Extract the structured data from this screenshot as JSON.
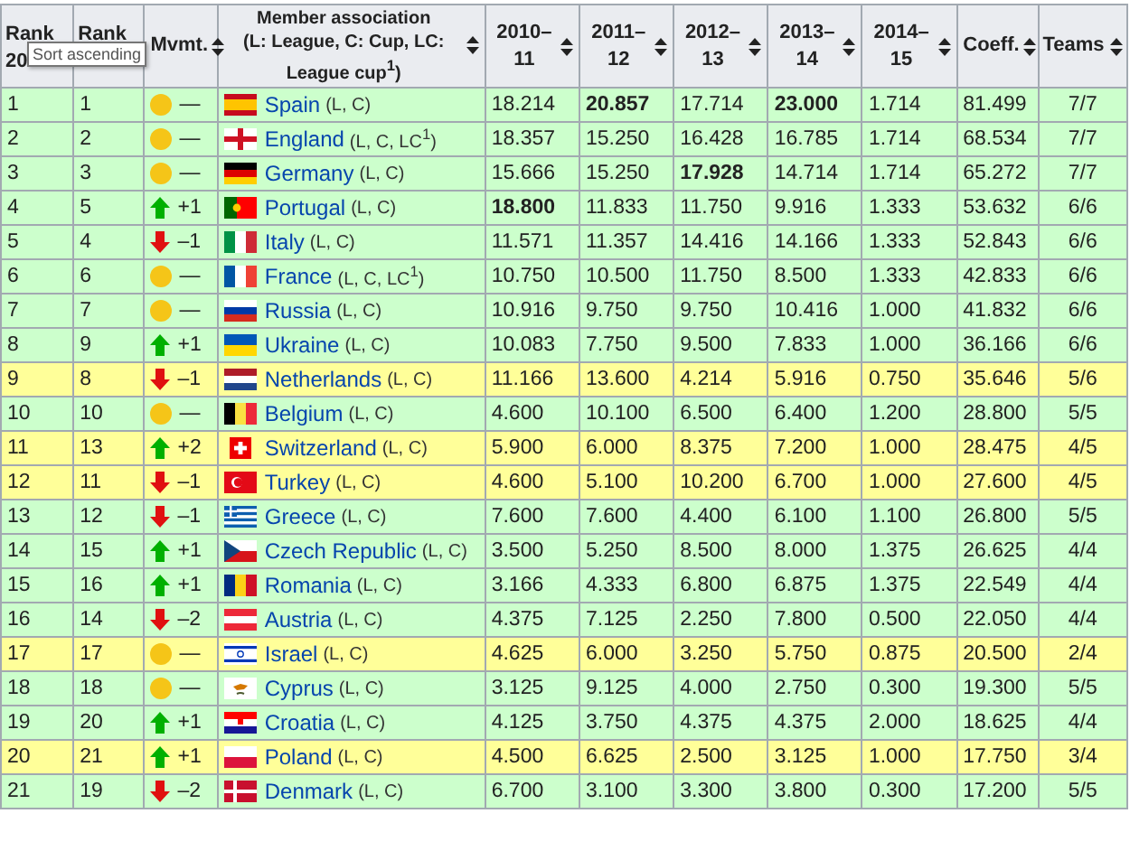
{
  "tooltip": "Sort ascending",
  "columns": [
    {
      "label": "Rank\n20",
      "sortable": false
    },
    {
      "label": "Rank",
      "sortable": false
    },
    {
      "label": "Mvmt.",
      "sortable": true
    },
    {
      "label": "Member association\n(L: League, C: Cup, LC: League cup$^{1}$)",
      "sortable": true
    },
    {
      "label": "2010–\n11",
      "sortable": true
    },
    {
      "label": "2011–\n12",
      "sortable": true
    },
    {
      "label": "2012–\n13",
      "sortable": true
    },
    {
      "label": "2013–\n14",
      "sortable": true
    },
    {
      "label": "2014–\n15",
      "sortable": true
    },
    {
      "label": "Coeff.",
      "sortable": true
    },
    {
      "label": "Teams",
      "sortable": true
    }
  ],
  "rows": [
    {
      "rank": "1",
      "prev": "1",
      "move": {
        "kind": "same",
        "text": "—"
      },
      "name": "Spain",
      "comps": "(L, C)",
      "seasons": [
        {
          "v": "18.214",
          "bold": false
        },
        {
          "v": "20.857",
          "bold": true
        },
        {
          "v": "17.714",
          "bold": false
        },
        {
          "v": "23.000",
          "bold": true
        },
        {
          "v": "1.714",
          "bold": false
        }
      ],
      "coeff": "81.499",
      "teams": "7/7",
      "color": "#ccffcc"
    },
    {
      "rank": "2",
      "prev": "2",
      "move": {
        "kind": "same",
        "text": "—"
      },
      "name": "England",
      "comps": "(L, C, LC$^{1}$)",
      "seasons": [
        {
          "v": "18.357",
          "bold": false
        },
        {
          "v": "15.250",
          "bold": false
        },
        {
          "v": "16.428",
          "bold": false
        },
        {
          "v": "16.785",
          "bold": false
        },
        {
          "v": "1.714",
          "bold": false
        }
      ],
      "coeff": "68.534",
      "teams": "7/7",
      "color": "#ccffcc"
    },
    {
      "rank": "3",
      "prev": "3",
      "move": {
        "kind": "same",
        "text": "—"
      },
      "name": "Germany",
      "comps": "(L, C)",
      "seasons": [
        {
          "v": "15.666",
          "bold": false
        },
        {
          "v": "15.250",
          "bold": false
        },
        {
          "v": "17.928",
          "bold": true
        },
        {
          "v": "14.714",
          "bold": false
        },
        {
          "v": "1.714",
          "bold": false
        }
      ],
      "coeff": "65.272",
      "teams": "7/7",
      "color": "#ccffcc"
    },
    {
      "rank": "4",
      "prev": "5",
      "move": {
        "kind": "up",
        "text": "+1"
      },
      "name": "Portugal",
      "comps": "(L, C)",
      "seasons": [
        {
          "v": "18.800",
          "bold": true
        },
        {
          "v": "11.833",
          "bold": false
        },
        {
          "v": "11.750",
          "bold": false
        },
        {
          "v": "9.916",
          "bold": false
        },
        {
          "v": "1.333",
          "bold": false
        }
      ],
      "coeff": "53.632",
      "teams": "6/6",
      "color": "#ccffcc"
    },
    {
      "rank": "5",
      "prev": "4",
      "move": {
        "kind": "down",
        "text": "–1"
      },
      "name": "Italy",
      "comps": "(L, C)",
      "seasons": [
        {
          "v": "11.571",
          "bold": false
        },
        {
          "v": "11.357",
          "bold": false
        },
        {
          "v": "14.416",
          "bold": false
        },
        {
          "v": "14.166",
          "bold": false
        },
        {
          "v": "1.333",
          "bold": false
        }
      ],
      "coeff": "52.843",
      "teams": "6/6",
      "color": "#ccffcc"
    },
    {
      "rank": "6",
      "prev": "6",
      "move": {
        "kind": "same",
        "text": "—"
      },
      "name": "France",
      "comps": "(L, C, LC$^{1}$)",
      "seasons": [
        {
          "v": "10.750",
          "bold": false
        },
        {
          "v": "10.500",
          "bold": false
        },
        {
          "v": "11.750",
          "bold": false
        },
        {
          "v": "8.500",
          "bold": false
        },
        {
          "v": "1.333",
          "bold": false
        }
      ],
      "coeff": "42.833",
      "teams": "6/6",
      "color": "#ccffcc"
    },
    {
      "rank": "7",
      "prev": "7",
      "move": {
        "kind": "same",
        "text": "—"
      },
      "name": "Russia",
      "comps": "(L, C)",
      "seasons": [
        {
          "v": "10.916",
          "bold": false
        },
        {
          "v": "9.750",
          "bold": false
        },
        {
          "v": "9.750",
          "bold": false
        },
        {
          "v": "10.416",
          "bold": false
        },
        {
          "v": "1.000",
          "bold": false
        }
      ],
      "coeff": "41.832",
      "teams": "6/6",
      "color": "#ccffcc"
    },
    {
      "rank": "8",
      "prev": "9",
      "move": {
        "kind": "up",
        "text": "+1"
      },
      "name": "Ukraine",
      "comps": "(L, C)",
      "seasons": [
        {
          "v": "10.083",
          "bold": false
        },
        {
          "v": "7.750",
          "bold": false
        },
        {
          "v": "9.500",
          "bold": false
        },
        {
          "v": "7.833",
          "bold": false
        },
        {
          "v": "1.000",
          "bold": false
        }
      ],
      "coeff": "36.166",
      "teams": "6/6",
      "color": "#ccffcc"
    },
    {
      "rank": "9",
      "prev": "8",
      "move": {
        "kind": "down",
        "text": "–1"
      },
      "name": "Netherlands",
      "comps": "(L, C)",
      "seasons": [
        {
          "v": "11.166",
          "bold": false
        },
        {
          "v": "13.600",
          "bold": false
        },
        {
          "v": "4.214",
          "bold": false
        },
        {
          "v": "5.916",
          "bold": false
        },
        {
          "v": "0.750",
          "bold": false
        }
      ],
      "coeff": "35.646",
      "teams": "5/6",
      "color": "#ffff99"
    },
    {
      "rank": "10",
      "prev": "10",
      "move": {
        "kind": "same",
        "text": "—"
      },
      "name": "Belgium",
      "comps": "(L, C)",
      "seasons": [
        {
          "v": "4.600",
          "bold": false
        },
        {
          "v": "10.100",
          "bold": false
        },
        {
          "v": "6.500",
          "bold": false
        },
        {
          "v": "6.400",
          "bold": false
        },
        {
          "v": "1.200",
          "bold": false
        }
      ],
      "coeff": "28.800",
      "teams": "5/5",
      "color": "#ccffcc"
    },
    {
      "rank": "11",
      "prev": "13",
      "move": {
        "kind": "up",
        "text": "+2"
      },
      "name": "Switzerland",
      "comps": "(L, C)",
      "seasons": [
        {
          "v": "5.900",
          "bold": false
        },
        {
          "v": "6.000",
          "bold": false
        },
        {
          "v": "8.375",
          "bold": false
        },
        {
          "v": "7.200",
          "bold": false
        },
        {
          "v": "1.000",
          "bold": false
        }
      ],
      "coeff": "28.475",
      "teams": "4/5",
      "color": "#ffff99"
    },
    {
      "rank": "12",
      "prev": "11",
      "move": {
        "kind": "down",
        "text": "–1"
      },
      "name": "Turkey",
      "comps": "(L, C)",
      "seasons": [
        {
          "v": "4.600",
          "bold": false
        },
        {
          "v": "5.100",
          "bold": false
        },
        {
          "v": "10.200",
          "bold": false
        },
        {
          "v": "6.700",
          "bold": false
        },
        {
          "v": "1.000",
          "bold": false
        }
      ],
      "coeff": "27.600",
      "teams": "4/5",
      "color": "#ffff99"
    },
    {
      "rank": "13",
      "prev": "12",
      "move": {
        "kind": "down",
        "text": "–1"
      },
      "name": "Greece",
      "comps": "(L, C)",
      "seasons": [
        {
          "v": "7.600",
          "bold": false
        },
        {
          "v": "7.600",
          "bold": false
        },
        {
          "v": "4.400",
          "bold": false
        },
        {
          "v": "6.100",
          "bold": false
        },
        {
          "v": "1.100",
          "bold": false
        }
      ],
      "coeff": "26.800",
      "teams": "5/5",
      "color": "#ccffcc"
    },
    {
      "rank": "14",
      "prev": "15",
      "move": {
        "kind": "up",
        "text": "+1"
      },
      "name": "Czech Republic",
      "comps": "(L, C)",
      "seasons": [
        {
          "v": "3.500",
          "bold": false
        },
        {
          "v": "5.250",
          "bold": false
        },
        {
          "v": "8.500",
          "bold": false
        },
        {
          "v": "8.000",
          "bold": false
        },
        {
          "v": "1.375",
          "bold": false
        }
      ],
      "coeff": "26.625",
      "teams": "4/4",
      "color": "#ccffcc"
    },
    {
      "rank": "15",
      "prev": "16",
      "move": {
        "kind": "up",
        "text": "+1"
      },
      "name": "Romania",
      "comps": "(L, C)",
      "seasons": [
        {
          "v": "3.166",
          "bold": false
        },
        {
          "v": "4.333",
          "bold": false
        },
        {
          "v": "6.800",
          "bold": false
        },
        {
          "v": "6.875",
          "bold": false
        },
        {
          "v": "1.375",
          "bold": false
        }
      ],
      "coeff": "22.549",
      "teams": "4/4",
      "color": "#ccffcc"
    },
    {
      "rank": "16",
      "prev": "14",
      "move": {
        "kind": "down",
        "text": "–2"
      },
      "name": "Austria",
      "comps": "(L, C)",
      "seasons": [
        {
          "v": "4.375",
          "bold": false
        },
        {
          "v": "7.125",
          "bold": false
        },
        {
          "v": "2.250",
          "bold": false
        },
        {
          "v": "7.800",
          "bold": false
        },
        {
          "v": "0.500",
          "bold": false
        }
      ],
      "coeff": "22.050",
      "teams": "4/4",
      "color": "#ccffcc"
    },
    {
      "rank": "17",
      "prev": "17",
      "move": {
        "kind": "same",
        "text": "—"
      },
      "name": "Israel",
      "comps": "(L, C)",
      "seasons": [
        {
          "v": "4.625",
          "bold": false
        },
        {
          "v": "6.000",
          "bold": false
        },
        {
          "v": "3.250",
          "bold": false
        },
        {
          "v": "5.750",
          "bold": false
        },
        {
          "v": "0.875",
          "bold": false
        }
      ],
      "coeff": "20.500",
      "teams": "2/4",
      "color": "#ffff99"
    },
    {
      "rank": "18",
      "prev": "18",
      "move": {
        "kind": "same",
        "text": "—"
      },
      "name": "Cyprus",
      "comps": "(L, C)",
      "seasons": [
        {
          "v": "3.125",
          "bold": false
        },
        {
          "v": "9.125",
          "bold": false
        },
        {
          "v": "4.000",
          "bold": false
        },
        {
          "v": "2.750",
          "bold": false
        },
        {
          "v": "0.300",
          "bold": false
        }
      ],
      "coeff": "19.300",
      "teams": "5/5",
      "color": "#ccffcc"
    },
    {
      "rank": "19",
      "prev": "20",
      "move": {
        "kind": "up",
        "text": "+1"
      },
      "name": "Croatia",
      "comps": "(L, C)",
      "seasons": [
        {
          "v": "4.125",
          "bold": false
        },
        {
          "v": "3.750",
          "bold": false
        },
        {
          "v": "4.375",
          "bold": false
        },
        {
          "v": "4.375",
          "bold": false
        },
        {
          "v": "2.000",
          "bold": false
        }
      ],
      "coeff": "18.625",
      "teams": "4/4",
      "color": "#ccffcc"
    },
    {
      "rank": "20",
      "prev": "21",
      "move": {
        "kind": "up",
        "text": "+1"
      },
      "name": "Poland",
      "comps": "(L, C)",
      "seasons": [
        {
          "v": "4.500",
          "bold": false
        },
        {
          "v": "6.625",
          "bold": false
        },
        {
          "v": "2.500",
          "bold": false
        },
        {
          "v": "3.125",
          "bold": false
        },
        {
          "v": "1.000",
          "bold": false
        }
      ],
      "coeff": "17.750",
      "teams": "3/4",
      "color": "#ffff99"
    },
    {
      "rank": "21",
      "prev": "19",
      "move": {
        "kind": "down",
        "text": "–2"
      },
      "name": "Denmark",
      "comps": "(L, C)",
      "seasons": [
        {
          "v": "6.700",
          "bold": false
        },
        {
          "v": "3.100",
          "bold": false
        },
        {
          "v": "3.300",
          "bold": false
        },
        {
          "v": "3.800",
          "bold": false
        },
        {
          "v": "0.300",
          "bold": false
        }
      ],
      "coeff": "17.200",
      "teams": "5/5",
      "color": "#ccffcc"
    }
  ]
}
